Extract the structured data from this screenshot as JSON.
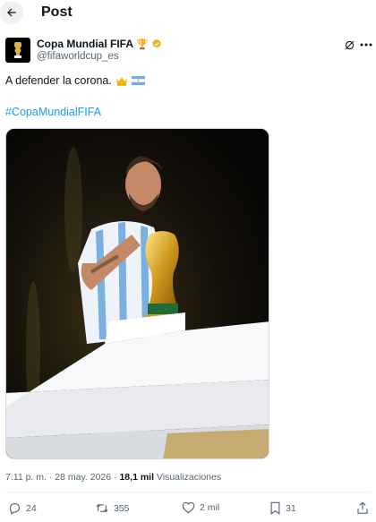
{
  "header": {
    "title": "Post",
    "back_icon": "arrow-left-icon"
  },
  "author": {
    "display_name": "Copa Mundial FIFA",
    "handle": "@fifaworldcup_es",
    "trophy_emoji": "🏆",
    "verified_color": "#e2b719"
  },
  "tweet": {
    "text": "A defender la corona.",
    "hashtag": "#CopaMundialFIFA",
    "emojis": [
      "crown-emoji",
      "argentina-flag-emoji"
    ]
  },
  "meta": {
    "time": "7:11 p. m.",
    "separator": "·",
    "date": "28 may. 2026",
    "views_count": "18,1 mil",
    "views_label": "Visualizaciones"
  },
  "actions": {
    "replies": "24",
    "reposts": "355",
    "likes": "2 mil",
    "bookmarks": "31"
  },
  "colors": {
    "link": "#1d9bf0",
    "muted": "#536471",
    "text": "#0f1419"
  }
}
